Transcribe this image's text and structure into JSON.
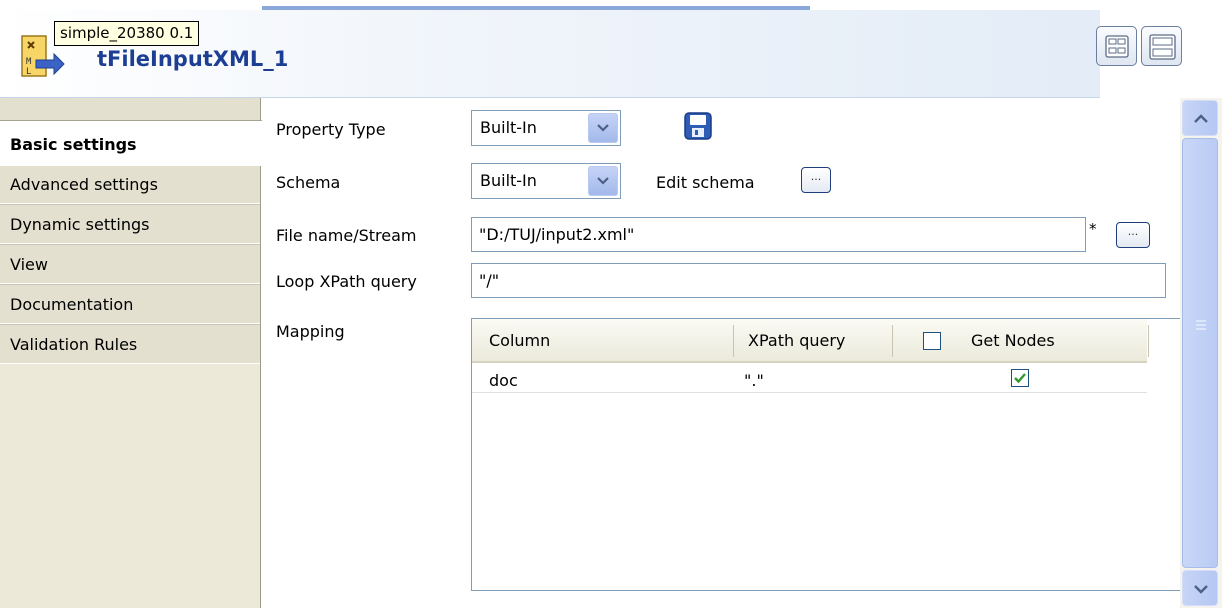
{
  "header": {
    "title": "tFileInputXML_1",
    "tooltip": "simple_20380 0.1",
    "component_icon": "xml-file-input-icon",
    "buttons": [
      {
        "name": "layout-grid-button",
        "icon": "grid-layout-icon"
      },
      {
        "name": "layout-rows-button",
        "icon": "rows-layout-icon"
      }
    ]
  },
  "tabs": [
    {
      "label": "Basic settings",
      "active": true
    },
    {
      "label": "Advanced settings",
      "active": false
    },
    {
      "label": "Dynamic settings",
      "active": false
    },
    {
      "label": "View",
      "active": false
    },
    {
      "label": "Documentation",
      "active": false
    },
    {
      "label": "Validation Rules",
      "active": false
    }
  ],
  "form": {
    "property_type": {
      "label": "Property Type",
      "value": "Built-In",
      "icon": "save-icon"
    },
    "schema": {
      "label": "Schema",
      "value": "Built-In",
      "edit_label": "Edit schema"
    },
    "file_name": {
      "label": "File name/Stream",
      "value": "\"D:/TUJ/input2.xml\"",
      "required_marker": "*"
    },
    "loop_xpath": {
      "label": "Loop XPath query",
      "value": "\"/\""
    },
    "mapping": {
      "label": "Mapping",
      "columns": [
        "Column",
        "XPath query",
        "Get Nodes"
      ],
      "header_checkbox_checked": false,
      "rows": [
        {
          "column": "doc",
          "xpath": "\".\"",
          "get_nodes": true
        }
      ]
    },
    "ellipsis": "..."
  },
  "colors": {
    "title_blue": "#1c3f94",
    "tab_bg": "#e3e0d0",
    "checkbox_green": "#2e9a2e"
  }
}
